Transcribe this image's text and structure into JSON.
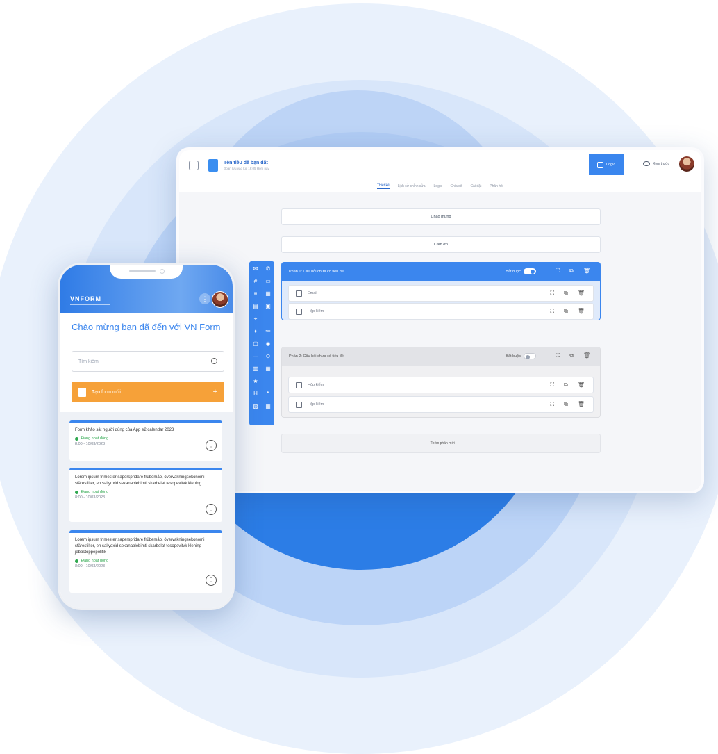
{
  "desktop": {
    "form_title": "Tên tiêu đề bạn đặt",
    "form_subtitle": "Đoạn lưu vào lúc 16:05 Hôm nay",
    "logic_button": "Logic",
    "preview_button": "Xem trước",
    "tabs": [
      "Thiết kế",
      "Lịch sử chỉnh sửa",
      "Logic",
      "Chia sẻ",
      "Cài đặt",
      "Phản hồi"
    ],
    "welcome_block": "Chào mừng",
    "thanks_block": "Cảm ơn",
    "toolbar_icons": [
      "✉",
      "✆",
      "#",
      "▭",
      "≡",
      "▦",
      "▤",
      "▣",
      "⌖",
      "",
      "♦",
      "≔",
      "▢",
      "◉",
      "—",
      "⊙",
      "▥",
      "▦",
      "★",
      "",
      "H",
      "❝",
      "▨",
      "▦"
    ],
    "section1": {
      "title": "Phần 1: Câu hỏi chưa có tiêu đề",
      "required": "Bắt buộc",
      "questions": [
        "Email",
        "Hộp kiểm"
      ]
    },
    "section2": {
      "title": "Phần 2: Câu hỏi chưa có tiêu đề",
      "required": "Bắt buộc",
      "questions": [
        "Hộp kiểm",
        "Hộp kiểm"
      ]
    },
    "add_section": "+ Thêm phần mới",
    "action_icons": {
      "expand": "⛶",
      "copy": "⧉",
      "delete": "🗑"
    }
  },
  "mobile": {
    "brand": "VNFORM",
    "welcome": "Chào mừng bạn đã đến với VN Form",
    "search_placeholder": "Tìm kiếm",
    "new_form": "Tạo form mới",
    "new_form_plus": "+",
    "cards": [
      {
        "title": "Form khảo sát người dùng của App e2 calendar 2023",
        "status": "Đang hoạt động",
        "date": "8:00 - 10/03/2023"
      },
      {
        "title": "Lorem ipsum frimester saperspridare frübemåo, övervakningsekonomi stäresfilter, en sallydxid sekanablebimti skarbelat tesopevitvk klening",
        "status": "Đang hoạt động",
        "date": "8:00 - 10/03/2023"
      },
      {
        "title": "Lorem ipsum frimester saperspridare frübemåo, övervakningsekonomi stäresfilter, en sallydxid sekanablebimti skarbelat tesopevitvk klening jebbstoppepolitik",
        "status": "Đang hoạt động",
        "date": "8:00 - 10/03/2023"
      }
    ]
  },
  "colors": {
    "accent": "#3b86ee",
    "orange": "#f6a139",
    "active": "#2fa84f"
  }
}
